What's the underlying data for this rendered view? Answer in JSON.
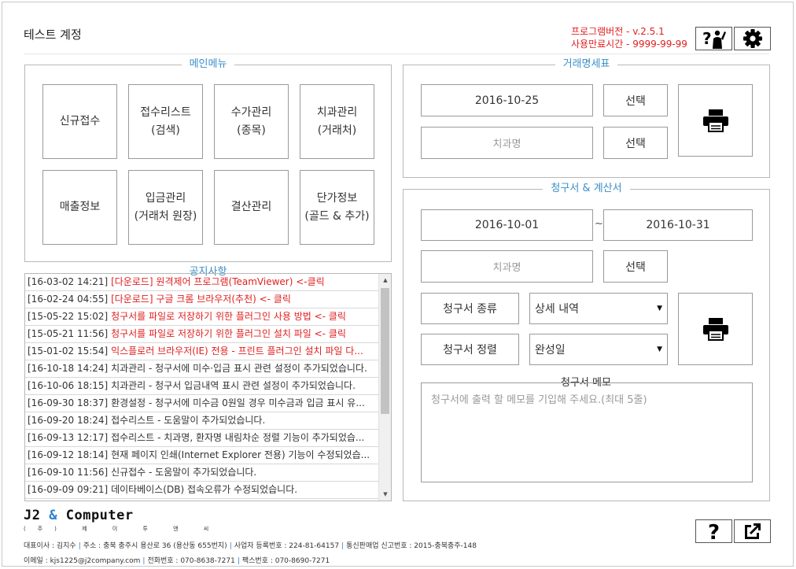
{
  "header": {
    "title": "테스트 계정",
    "version_line": "프로그램버전 - v.2.5.1",
    "expiry_line": "사용만료시간 - 9999-99-99",
    "help_icon": "help-person-icon",
    "settings_icon": "gear-icon"
  },
  "main_menu": {
    "title": "메인메뉴",
    "buttons": [
      {
        "line1": "신규접수",
        "line2": ""
      },
      {
        "line1": "접수리스트",
        "line2": "(검색)"
      },
      {
        "line1": "수가관리",
        "line2": "(종목)"
      },
      {
        "line1": "치과관리",
        "line2": "(거래처)"
      },
      {
        "line1": "매출정보",
        "line2": ""
      },
      {
        "line1": "입금관리",
        "line2": "(거래처 원장)"
      },
      {
        "line1": "결산관리",
        "line2": ""
      },
      {
        "line1": "단가정보",
        "line2": "(골드 & 추가)"
      }
    ]
  },
  "notices": {
    "title": "공지사항",
    "rows": [
      {
        "date": "[16-03-02 14:21]",
        "text": "[다운로드] 원격제어 프로그램(TeamViewer) <-클릭",
        "red": true
      },
      {
        "date": "[16-02-24 04:55]",
        "text": "[다운로드] 구글 크롬 브라우저(추천) <- 클릭",
        "red": true
      },
      {
        "date": "[15-05-22 15:02]",
        "text": "청구서를 파일로 저장하기 위한 플러그인 사용 방법 <- 클릭",
        "red": true
      },
      {
        "date": "[15-05-21 11:56]",
        "text": "청구서를 파일로 저장하기 위한 플러그인 설치 파일 <- 클릭",
        "red": true
      },
      {
        "date": "[15-01-02 15:54]",
        "text": "익스플로러 브라우저(IE) 전용 - 프린트 플러그인 설치 파일 다...",
        "red": true
      },
      {
        "date": "[16-10-18 14:24]",
        "text": "치과관리 - 청구서에 미수·입금 표시 관련 설정이 추가되었습니다.",
        "red": false
      },
      {
        "date": "[16-10-06 18:15]",
        "text": "치과관리 - 청구서 입금내역 표시 관련 설정이 추가되었습니다.",
        "red": false
      },
      {
        "date": "[16-09-30 18:37]",
        "text": "환경설정 - 청구서에 미수금 0원일 경우 미수금과 입금 표시 유...",
        "red": false
      },
      {
        "date": "[16-09-20 18:24]",
        "text": "접수리스트 - 도움말이 추가되었습니다.",
        "red": false
      },
      {
        "date": "[16-09-13 12:17]",
        "text": "접수리스트 - 치과명, 환자명 내림차순 정렬 기능이 추가되었습...",
        "red": false
      },
      {
        "date": "[16-09-12 18:14]",
        "text": "현재 페이지 인쇄(Internet Explorer 전용) 기능이 수정되었습...",
        "red": false
      },
      {
        "date": "[16-09-10 11:56]",
        "text": "신규접수 - 도움말이 추가되었습니다.",
        "red": false
      },
      {
        "date": "[16-09-09 09:21]",
        "text": "데이타베이스(DB) 접속오류가 수정되었습니다.",
        "red": false
      }
    ]
  },
  "transaction": {
    "title": "거래명세표",
    "date": "2016-10-25",
    "select_label": "선택",
    "clinic_placeholder": "치과명",
    "clinic_select_label": "선택",
    "print_icon": "printer-icon"
  },
  "invoice": {
    "title": "청구서 & 계산서",
    "date_from": "2016-10-01",
    "tilde": "~",
    "date_to": "2016-10-31",
    "clinic_placeholder": "치과명",
    "clinic_select_label": "선택",
    "type_label": "청구서 종류",
    "type_value": "상세 내역",
    "sort_label": "청구서 정렬",
    "sort_value": "완성일",
    "print_icon": "printer-icon",
    "memo_label": "청구서 메모",
    "memo_placeholder": "청구서에 출력 할 메모를 기입해 주세요.(최대 5줄)"
  },
  "footer": {
    "logo_text": "J2",
    "logo_amp": "&",
    "logo_company": "Computer",
    "logo_sub": "(주) 제 이 투 앤 씨",
    "line1": [
      "대표이사 : 김지수",
      "주소 : 충북 충주시 용산로 36 (용산동 655번지)",
      "사업자 등록번호 : 224-81-64157",
      "통신판매업 신고번호 : 2015-충북충주-148"
    ],
    "line2": [
      "이메일 : kjs1225@j2company.com",
      "전화번호 : 070-8638-7271",
      "팩스번호 : 070-8690-7271"
    ],
    "help_icon": "question-icon",
    "external_icon": "external-link-icon"
  }
}
